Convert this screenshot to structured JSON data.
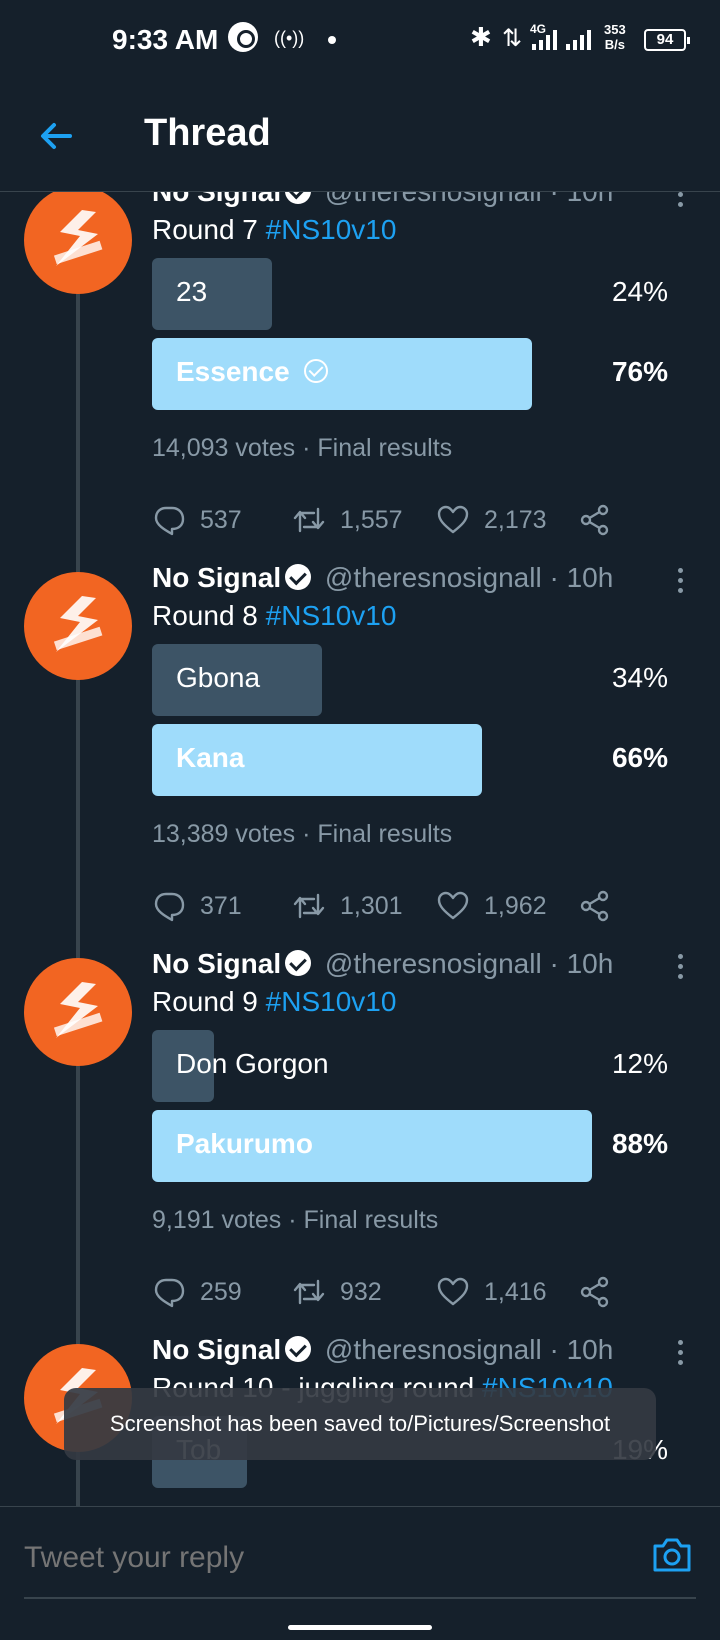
{
  "status_bar": {
    "time": "9:33 AM",
    "network": "4G",
    "speed_value": "353",
    "speed_unit": "B/s",
    "battery": "94"
  },
  "header": {
    "back_icon": "arrow-left-icon",
    "title": "Thread"
  },
  "colors": {
    "background": "#15202b",
    "accent": "#1da1f2",
    "winner_bar": "#9fdcfb",
    "loser_bar": "#3d5466",
    "muted_text": "#8899a6",
    "avatar": "#f26522"
  },
  "tweets": [
    {
      "name": "No Signal",
      "handle": "@theresnosignall",
      "separator": "·",
      "time": "10h",
      "text": "Round 7",
      "hashtag": "#NS10v10",
      "poll": [
        {
          "label": "23",
          "percent": "24%",
          "value": 24,
          "winner": false
        },
        {
          "label": "Essence",
          "percent": "76%",
          "value": 76,
          "winner": true
        }
      ],
      "votes": "14,093 votes",
      "dot": "·",
      "status": "Final results",
      "replies": "537",
      "retweets": "1,557",
      "likes": "2,173"
    },
    {
      "name": "No Signal",
      "handle": "@theresnosignall",
      "separator": "·",
      "time": "10h",
      "text": "Round 8",
      "hashtag": "#NS10v10",
      "poll": [
        {
          "label": "Gbona",
          "percent": "34%",
          "value": 34,
          "winner": false
        },
        {
          "label": "Kana",
          "percent": "66%",
          "value": 66,
          "winner": true
        }
      ],
      "votes": "13,389 votes",
      "dot": "·",
      "status": "Final results",
      "replies": "371",
      "retweets": "1,301",
      "likes": "1,962"
    },
    {
      "name": "No Signal",
      "handle": "@theresnosignall",
      "separator": "·",
      "time": "10h",
      "text": "Round 9",
      "hashtag": "#NS10v10",
      "poll": [
        {
          "label": "Don Gorgon",
          "percent": "12%",
          "value": 12,
          "winner": false
        },
        {
          "label": "Pakurumo",
          "percent": "88%",
          "value": 88,
          "winner": true
        }
      ],
      "votes": "9,191 votes",
      "dot": "·",
      "status": "Final results",
      "replies": "259",
      "retweets": "932",
      "likes": "1,416"
    },
    {
      "name": "No Signal",
      "handle": "@theresnosignall",
      "separator": "·",
      "time": "10h",
      "text": "Round 10 - juggling round",
      "hashtag": "#NS10v10",
      "poll": [
        {
          "label": "Tob",
          "percent": "19%",
          "value": 19,
          "winner": false
        }
      ]
    }
  ],
  "toast": "Screenshot has been saved to/Pictures/Screenshot",
  "reply": {
    "placeholder": "Tweet your reply",
    "camera_icon": "camera-icon"
  }
}
